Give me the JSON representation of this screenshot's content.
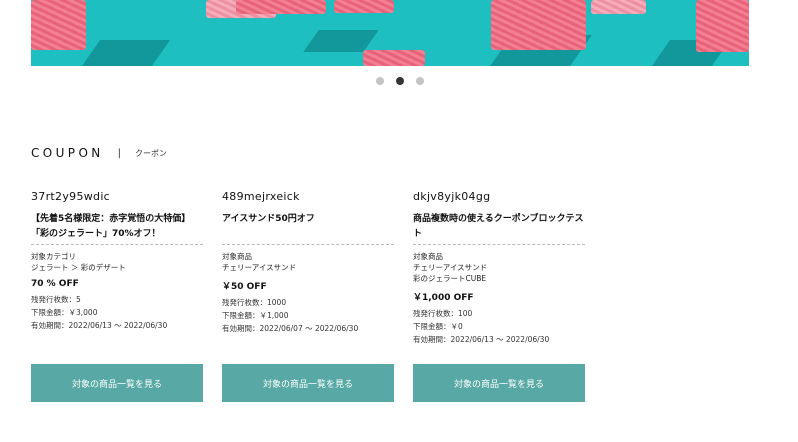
{
  "carousel": {
    "slides": 3,
    "active_index": 1
  },
  "section": {
    "title": "COUPON",
    "separator": "|",
    "subtitle": "クーポン"
  },
  "coupons": [
    {
      "code": "37rt2y95wdic",
      "name": "【先着5名様限定：赤字覚悟の大特価】「彩のジェラート」70%オフ！",
      "target_label": "対象カテゴリ",
      "targets": [
        "ジェラート ＞ 彩のデザート"
      ],
      "discount": "70 % OFF",
      "remaining": "残発行枚数：5",
      "min_amount": "下限金額：￥3,000",
      "period": "有効期間：2022/06/13 ～ 2022/06/30",
      "button": "対象の商品一覧を見る"
    },
    {
      "code": "489mejrxeick",
      "name": "アイスサンド50円オフ",
      "target_label": "対象商品",
      "targets": [
        "チェリーアイスサンド"
      ],
      "discount": "￥50 OFF",
      "remaining": "残発行枚数：1000",
      "min_amount": "下限金額：￥1,000",
      "period": "有効期間：2022/06/07 ～ 2022/06/30",
      "button": "対象の商品一覧を見る"
    },
    {
      "code": "dkjv8yjk04gg",
      "name": "商品複数時の使えるクーポンブロックテスト",
      "target_label": "対象商品",
      "targets": [
        "チェリーアイスサンド",
        "彩のジェラートCUBE"
      ],
      "discount": "￥1,000 OFF",
      "remaining": "残発行枚数：100",
      "min_amount": "下限金額：￥0",
      "period": "有効期間：2022/06/13 ～ 2022/06/30",
      "button": "対象の商品一覧を見る"
    }
  ],
  "colors": {
    "banner_bg": "#1dbfc1",
    "button_bg": "#58a9a6",
    "dot_active": "#333333",
    "dot_inactive": "#c4c4c4"
  }
}
